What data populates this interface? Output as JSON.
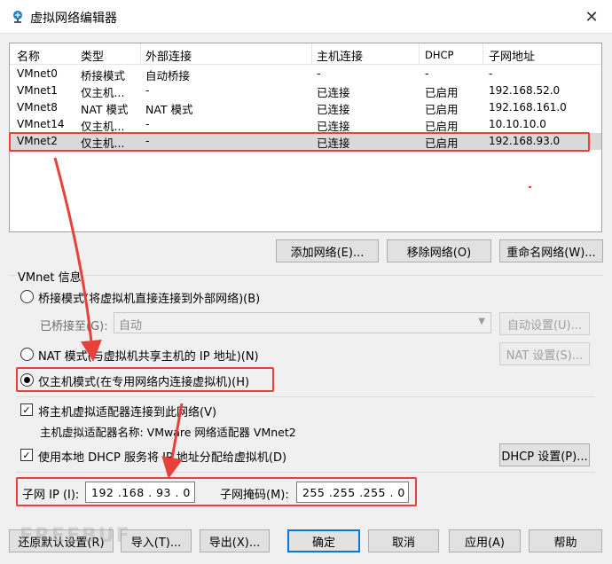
{
  "window": {
    "title": "虚拟网络编辑器",
    "close_glyph": "✕"
  },
  "list": {
    "headers": [
      "名称",
      "类型",
      "外部连接",
      "主机连接",
      "DHCP",
      "子网地址"
    ],
    "rows": [
      [
        "VMnet0",
        "桥接模式",
        "自动桥接",
        "-",
        "-",
        "-"
      ],
      [
        "VMnet1",
        "仅主机...",
        "-",
        "已连接",
        "已启用",
        "192.168.52.0"
      ],
      [
        "VMnet8",
        "NAT 模式",
        "NAT 模式",
        "已连接",
        "已启用",
        "192.168.161.0"
      ],
      [
        "VMnet14",
        "仅主机...",
        "-",
        "已连接",
        "已启用",
        "10.10.10.0"
      ],
      [
        "VMnet2",
        "仅主机...",
        "-",
        "已连接",
        "已启用",
        "192.168.93.0"
      ]
    ],
    "selected_index": 4
  },
  "list_buttons": {
    "add": "添加网络(E)...",
    "remove": "移除网络(O)",
    "rename": "重命名网络(W)..."
  },
  "vmnet_info": {
    "label": "VMnet 信息",
    "bridged": {
      "label": "桥接模式(将虚拟机直接连接到外部网络)(B)",
      "selected": false
    },
    "bridged_to": {
      "label": "已桥接至(G):",
      "value": "自动",
      "auto_button": "自动设置(U)..."
    },
    "nat": {
      "label": "NAT 模式(与虚拟机共享主机的 IP 地址)(N)",
      "selected": false,
      "settings_button": "NAT 设置(S)..."
    },
    "host_only": {
      "label": "仅主机模式(在专用网络内连接虚拟机)(H)",
      "selected": true
    },
    "connect_adapter": {
      "label": "将主机虚拟适配器连接到此网络(V)",
      "checked": true
    },
    "adapter_name": "主机虚拟适配器名称: VMware 网络适配器 VMnet2",
    "use_dhcp": {
      "label": "使用本地 DHCP 服务将 IP 地址分配给虚拟机(D)",
      "checked": true
    },
    "dhcp_button": "DHCP 设置(P)...",
    "subnet_ip": {
      "label": "子网 IP (I):",
      "value": "192 .168 . 93  .  0"
    },
    "subnet_mask": {
      "label": "子网掩码(M):",
      "value": "255 .255 .255 .  0"
    }
  },
  "footer": {
    "restore": "还原默认设置(R)",
    "import": "导入(T)...",
    "export": "导出(X)...",
    "ok": "确定",
    "cancel": "取消",
    "apply": "应用(A)",
    "help": "帮助"
  },
  "watermark": "FREEBUF",
  "colors": {
    "highlight": "#e8413c",
    "focus": "#0078d7",
    "selected_row": "#d9d9d9"
  }
}
